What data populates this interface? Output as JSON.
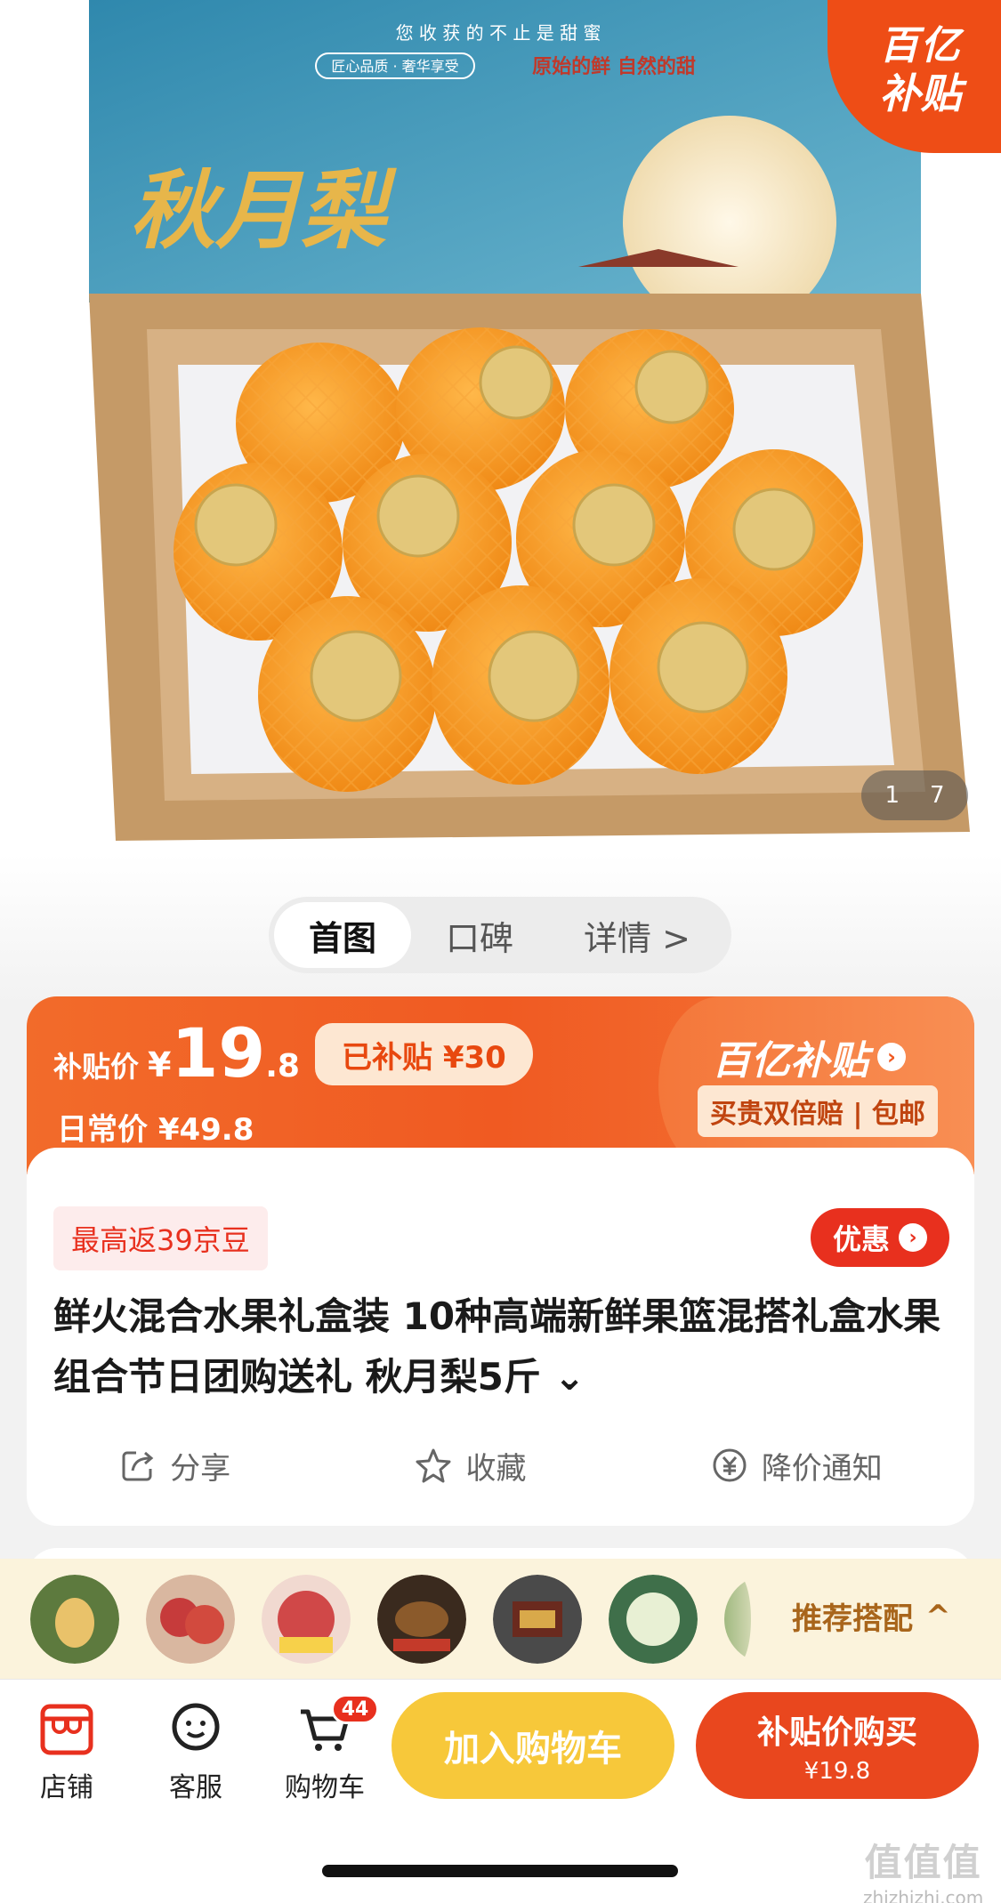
{
  "hero": {
    "badge_line1": "百亿",
    "badge_line2": "补贴",
    "box_slogan": "您 收 获 的 不 止 是 甜 蜜",
    "box_tag": "匠心品质 · 奢华享受",
    "box_tagline": "原始的鲜 自然的甜",
    "box_brand": "秋月梨",
    "page_current": "1",
    "page_total": "7"
  },
  "tabs": [
    {
      "label": "首图"
    },
    {
      "label": "口碑"
    },
    {
      "label": "详情 >"
    }
  ],
  "price": {
    "label": "补贴价",
    "currency": "¥",
    "integer": "19",
    "decimal": ".8",
    "subsidized": "已补贴 ¥30",
    "daily": "日常价 ¥49.8",
    "brand": "百亿补贴",
    "brand_arrow": "›",
    "guarantee": "买贵双倍赔 | 包邮"
  },
  "info": {
    "beans": "最高返39京豆",
    "coupon": "优惠",
    "coupon_arrow": "›",
    "title": "鲜火混合水果礼盒装 10种高端新鲜果篮混搭礼盒水果组合节日团购送礼 秋月梨5斤 ⌄",
    "actions": [
      {
        "label": "分享",
        "icon": "share-icon"
      },
      {
        "label": "收藏",
        "icon": "star-icon"
      },
      {
        "label": "降价通知",
        "icon": "price-alert-icon"
      }
    ]
  },
  "recommend": {
    "label": "推荐搭配",
    "arrow": "^",
    "thumbs": [
      {
        "color": "#8aa36a"
      },
      {
        "color": "#c63b3b"
      },
      {
        "color": "#d04848"
      },
      {
        "color": "#8b5a2b"
      },
      {
        "color": "#6a2a1e"
      },
      {
        "color": "#b9c79a"
      },
      {
        "color": "#7aa05a"
      }
    ]
  },
  "bottom": {
    "store": "店铺",
    "service": "客服",
    "cart": "购物车",
    "cart_count": "44",
    "add_to_cart": "加入购物车",
    "buy_line1": "补贴价购买",
    "buy_line2": "¥19.8",
    "watermark_logo": "值值值",
    "watermark_url": "zhizhizhi.com"
  },
  "colors": {
    "accent": "#f05a22",
    "red": "#e8301e",
    "yellow": "#f7c83a"
  }
}
